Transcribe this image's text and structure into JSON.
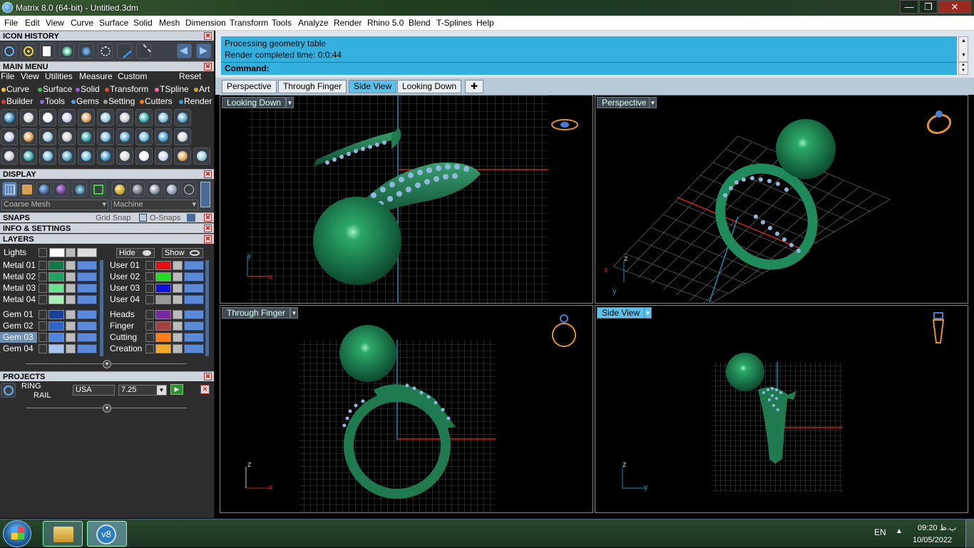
{
  "window": {
    "title": "Matrix 8.0 (64-bit) - Untitled.3dm",
    "minimize": "—",
    "maximize": "❐",
    "close": "✕"
  },
  "menubar": {
    "items": [
      "File",
      "Edit",
      "View",
      "Curve",
      "Surface",
      "Solid",
      "Mesh",
      "Dimension",
      "Transform",
      "Tools",
      "Analyze",
      "Render",
      "Rhino 5.0",
      "Blend",
      "T-Splines",
      "Help"
    ]
  },
  "icon_history": {
    "title": "ICON HISTORY"
  },
  "main_menu": {
    "title": "MAIN MENU",
    "top_items": [
      "File",
      "View",
      "Utilities",
      "Measure",
      "Custom"
    ],
    "reset": "Reset",
    "row1": [
      "Curve",
      "Surface",
      "Solid",
      "Transform",
      "TSpline",
      "Art"
    ],
    "row2": [
      "Builder",
      "Tools",
      "Gems",
      "Setting",
      "Cutters",
      "Render"
    ]
  },
  "display": {
    "title": "DISPLAY",
    "mesh_select": "Coarse Mesh",
    "material_select": "Machine"
  },
  "snaps": {
    "title": "SNAPS",
    "grid_snap": "Grid Snap",
    "osnaps": "O-Snaps"
  },
  "info": {
    "title": "INFO & SETTINGS"
  },
  "layers": {
    "title": "LAYERS",
    "lights": "Lights",
    "hide": "Hide",
    "show": "Show",
    "left": [
      {
        "name": "Metal 01",
        "color": "#0f7a45"
      },
      {
        "name": "Metal 02",
        "color": "#1fa560"
      },
      {
        "name": "Metal 03",
        "color": "#66e38e"
      },
      {
        "name": "Metal 04",
        "color": "#a9f0b7"
      },
      {
        "name": "Gem 01",
        "color": "#1b3f9a"
      },
      {
        "name": "Gem 02",
        "color": "#2e63c9"
      },
      {
        "name": "Gem 03",
        "color": "#4f86e0"
      },
      {
        "name": "Gem 04",
        "color": "#a7c5ef"
      }
    ],
    "right": [
      {
        "name": "User 01",
        "color": "#e01010"
      },
      {
        "name": "User 02",
        "color": "#22dd22"
      },
      {
        "name": "User 03",
        "color": "#1010dd"
      },
      {
        "name": "User 04",
        "color": "#9a9a9a"
      },
      {
        "name": "Heads",
        "color": "#7a2aa0"
      },
      {
        "name": "Finger",
        "color": "#a34040"
      },
      {
        "name": "Cutting",
        "color": "#ff7d1a"
      },
      {
        "name": "Creation",
        "color": "#f2a92a"
      }
    ]
  },
  "projects": {
    "title": "PROJECTS",
    "project_name_1": "RING",
    "project_name_2": "RAIL",
    "region": "USA",
    "size": "7.25"
  },
  "command": {
    "lines": [
      "Processing geometry table",
      "Render completed time: 0:0:44"
    ],
    "prompt": "Command:"
  },
  "tabs": [
    "Perspective",
    "Through Finger",
    "Side View",
    "Looking Down"
  ],
  "active_tab": "Side View",
  "viewports": {
    "top_left": "Looking Down",
    "top_right": "Perspective",
    "bottom_left": "Through Finger",
    "bottom_right": "Side View"
  },
  "axes": {
    "x": "x",
    "y": "y",
    "z": "z"
  },
  "taskbar": {
    "lang": "EN",
    "time": "09:20 ب.ظ",
    "date": "10/05/2022",
    "matrix_label": "v8"
  }
}
